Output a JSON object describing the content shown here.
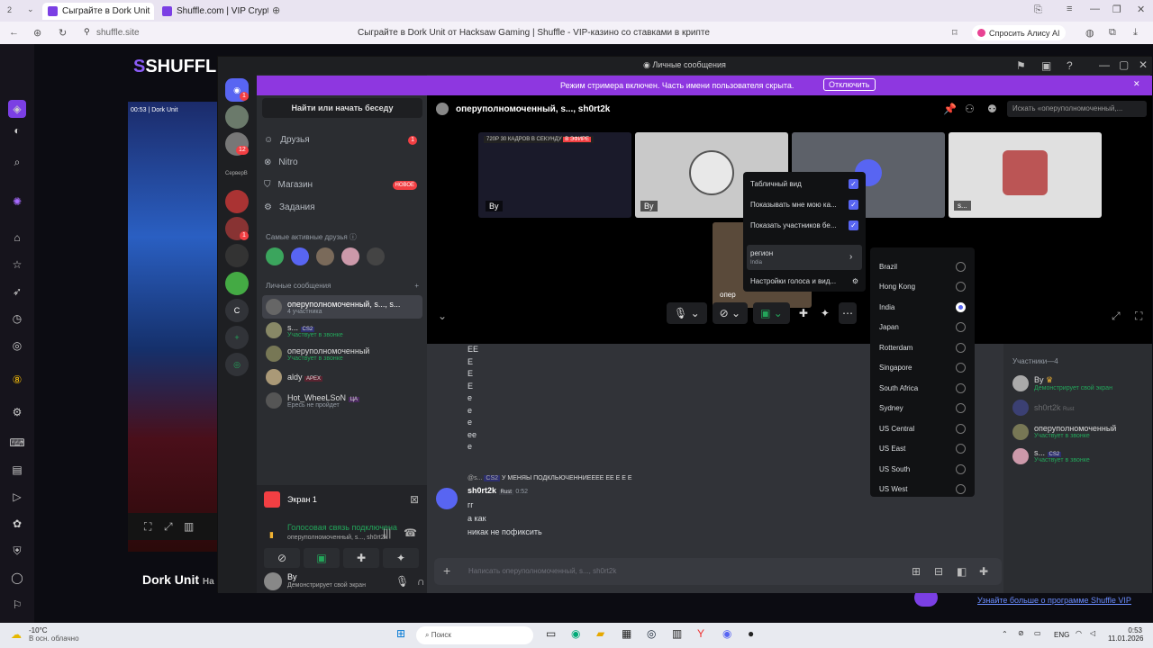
{
  "browser": {
    "tab_count": "2",
    "tabs": [
      "Сыграйте в Dork Unit",
      "Shuffle.com | VIP Crypto C"
    ],
    "url": "shuffle.site",
    "page_title": "Сыграйте в Dork Unit от Hacksaw Gaming | Shuffle - VIP-казино со ставками в крипте",
    "alice": "Спросить Алису AI"
  },
  "site": {
    "logo": "SHUFFL",
    "game_time": "00:53",
    "game_name": "Dork Unit",
    "game_title": "Dork Unit",
    "game_title_suffix": "Ha",
    "promo": "Узнайте больше о программе Shuffle VIP"
  },
  "discord": {
    "window_title": "Личные сообщения",
    "banner_text": "Режим стримера включен. Часть имени пользователя скрыта.",
    "banner_button": "Отключить",
    "search_conv": "Найти или начать беседу",
    "nav": [
      {
        "label": "Друзья",
        "badge": "1"
      },
      {
        "label": "Nitro",
        "badge": ""
      },
      {
        "label": "Магазин",
        "badge": "НОВОЕ"
      },
      {
        "label": "Задания",
        "badge": ""
      }
    ],
    "active_friends": "Самые активные друзья",
    "dm_header": "Личные сообщения",
    "dms": [
      {
        "name": "оперуполномоченный, s..., s...",
        "sub": "4 участника"
      },
      {
        "name": "s...",
        "tag": "CS2",
        "sub": "Участвует в звонке"
      },
      {
        "name": "оперуполномоченный",
        "sub": "Участвует в звонке"
      },
      {
        "name": "aldy",
        "tag": "APEX",
        "sub": ""
      },
      {
        "name": "Hot_WheeLSoN",
        "tag": "ЦА",
        "sub": "Ересь не пройдет"
      }
    ],
    "guild_badges": [
      "1",
      "12",
      "1"
    ],
    "guild_label": "СерверВ",
    "guild_letter": "С",
    "screen_label": "Экран 1",
    "voice_connected": "Голосовая связь подключена",
    "voice_channel": "оперуполномоченный, s..., sh0rt2k",
    "user_name": "By",
    "user_status": "Демонстрирует свой экран",
    "channel_title": "оперуполномоченный, s..., sh0rt2k",
    "search_placeholder": "Искать «оперуполномоченный,...",
    "stream_tag": "720P 30 КАДРОВ В СЕКУНДУ",
    "live": "В ЭФИРЕ",
    "tile_labels": [
      "By",
      "By",
      "",
      "s..."
    ],
    "overflow_label": "опер",
    "menu": [
      {
        "label": "Табличный вид",
        "checked": true
      },
      {
        "label": "Показывать мне мою ка...",
        "checked": true
      },
      {
        "label": "Показать участников бе...",
        "checked": true
      }
    ],
    "region_label": "регион",
    "region_value": "India",
    "voice_settings": "Настройки голоса и вид...",
    "regions": [
      {
        "name": "Brazil",
        "on": false
      },
      {
        "name": "Hong Kong",
        "on": false
      },
      {
        "name": "India",
        "on": true
      },
      {
        "name": "Japan",
        "on": false
      },
      {
        "name": "Rotterdam",
        "on": false
      },
      {
        "name": "Singapore",
        "on": false
      },
      {
        "name": "South Africa",
        "on": false
      },
      {
        "name": "Sydney",
        "on": false
      },
      {
        "name": "US Central",
        "on": false
      },
      {
        "name": "US East",
        "on": false
      },
      {
        "name": "US South",
        "on": false
      },
      {
        "name": "US West",
        "on": false
      }
    ],
    "chat_lines": [
      "EE",
      "E",
      "E",
      "E",
      "е",
      "е",
      "е",
      "ее",
      "е"
    ],
    "reply_user": "@s...",
    "reply_tag": "CS2",
    "reply_text": "У МЕНЯЫ ПОДКЛЬЮЧЕННИЕЕЕЕ  ЕЕ Е Е Е",
    "msg_author": "sh0rt2k",
    "msg_tag": "Rust",
    "msg_time": "0:52",
    "msg_lines": [
      "гг",
      "а как",
      "никак не пофиксить"
    ],
    "composer_placeholder": "Написать оперуполномоченный, s..., sh0rt2k",
    "members_header": "Участники—4",
    "members": [
      {
        "name": "By",
        "sub": "Демонстрирует свой экран"
      },
      {
        "name": "sh0rt2k",
        "sub": "Rust"
      },
      {
        "name": "оперуполномоченный",
        "sub": "Участвует в звонке"
      },
      {
        "name": "s...",
        "tag": "CS2",
        "sub": "Участвует в звонке"
      }
    ]
  },
  "taskbar": {
    "temp": "-10°C",
    "weather": "В осн. облачно",
    "search": "Поиск",
    "lang": "ENG",
    "time": "0:53",
    "date": "11.01.2026"
  }
}
